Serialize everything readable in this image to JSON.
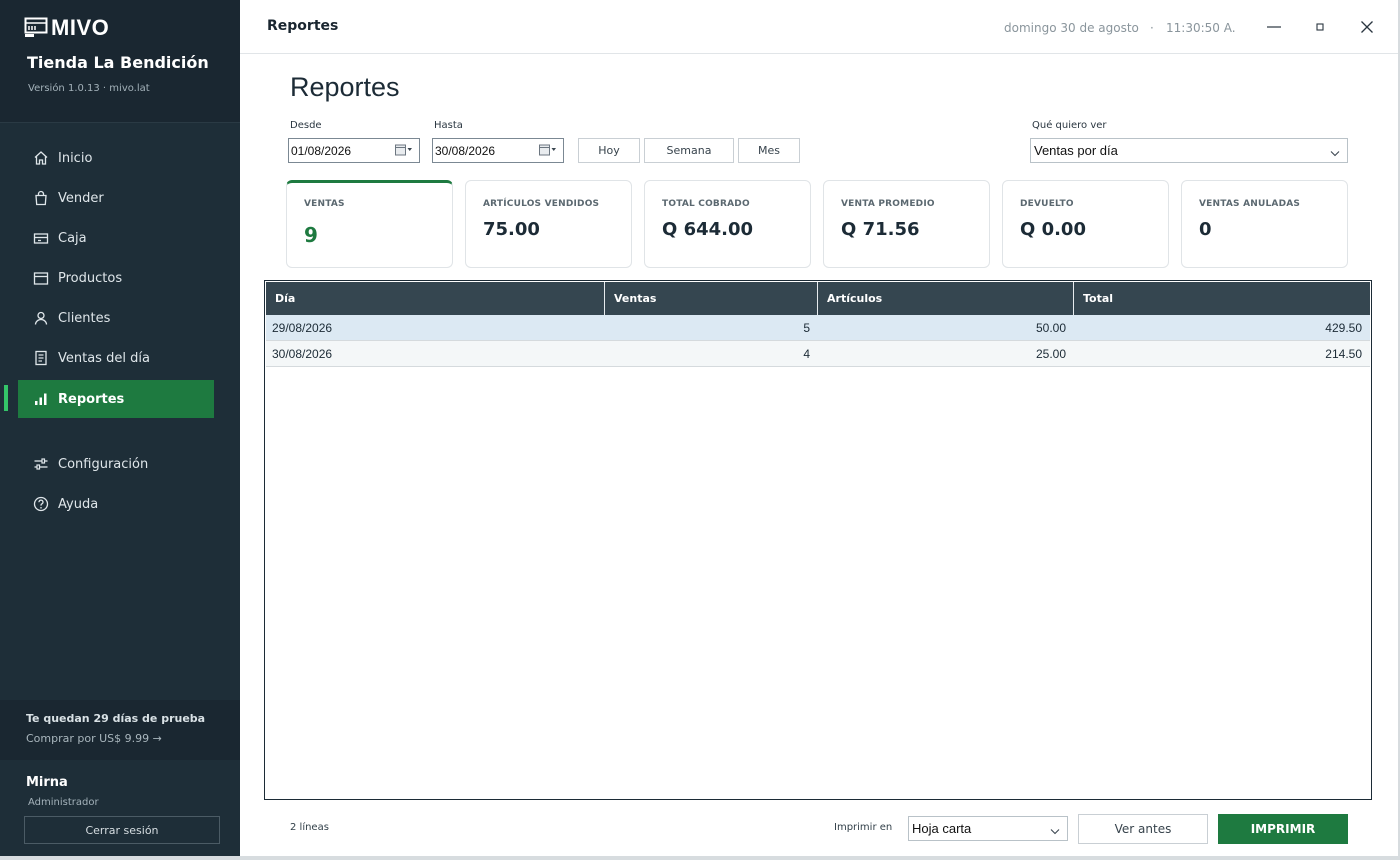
{
  "app": {
    "brand": "MIVO",
    "store_name": "Tienda La Bendición",
    "version": "Versión 1.0.13 · mivo.lat"
  },
  "sidebar": {
    "items": [
      {
        "label": "Inicio",
        "icon": "home-icon"
      },
      {
        "label": "Vender",
        "icon": "bag-icon"
      },
      {
        "label": "Caja",
        "icon": "cash-register-icon"
      },
      {
        "label": "Productos",
        "icon": "box-icon"
      },
      {
        "label": "Clientes",
        "icon": "user-icon"
      },
      {
        "label": "Ventas del día",
        "icon": "receipt-icon"
      },
      {
        "label": "Reportes",
        "icon": "bar-chart-icon",
        "active": true
      },
      {
        "label": "Configuración",
        "icon": "sliders-icon"
      },
      {
        "label": "Ayuda",
        "icon": "help-icon"
      }
    ],
    "trial_text": "Te quedan 29 días de prueba",
    "trial_link": "Comprar por US$ 9.99 →",
    "user_name": "Mirna",
    "user_role": "Administrador",
    "logout_label": "Cerrar sesión"
  },
  "titlebar": {
    "title": "Reportes",
    "date": "domingo 30 de agosto",
    "separator": "·",
    "time": "11:30:50 A."
  },
  "page": {
    "title": "Reportes",
    "from_label": "Desde",
    "from_value": "01/08/2026",
    "to_label": "Hasta",
    "to_value": "30/08/2026",
    "quick": [
      "Hoy",
      "Semana",
      "Mes"
    ],
    "view_label": "Qué quiero ver",
    "view_value": "Ventas por día"
  },
  "kpis": [
    {
      "title": "VENTAS",
      "value": "9"
    },
    {
      "title": "ARTÍCULOS VENDIDOS",
      "value": "75.00"
    },
    {
      "title": "TOTAL COBRADO",
      "value": "Q 644.00"
    },
    {
      "title": "VENTA PROMEDIO",
      "value": "Q 71.56"
    },
    {
      "title": "DEVUELTO",
      "value": "Q 0.00"
    },
    {
      "title": "VENTAS ANULADAS",
      "value": "0"
    }
  ],
  "table": {
    "headers": [
      "Día",
      "Ventas",
      "Artículos",
      "Total"
    ],
    "rows": [
      [
        "29/08/2026",
        "5",
        "50.00",
        "429.50"
      ],
      [
        "30/08/2026",
        "4",
        "25.00",
        "214.50"
      ]
    ]
  },
  "footer": {
    "lines": "2 líneas",
    "print_label": "Imprimir en",
    "print_value": "Hoja carta",
    "preview_label": "Ver antes",
    "print_button": "IMPRIMIR"
  },
  "colors": {
    "sidebar_bg": "#1e2e38",
    "accent_green": "#1e7a40",
    "table_header": "#354650",
    "selected_row": "#dce9f3"
  }
}
